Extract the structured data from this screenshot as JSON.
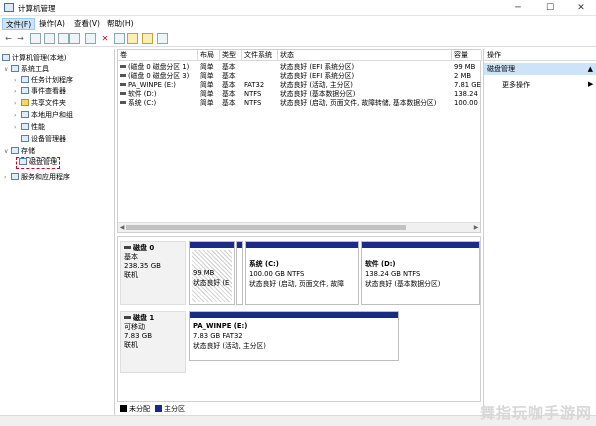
{
  "window": {
    "title": "计算机管理",
    "minimize": "─",
    "maximize": "☐",
    "close": "✕"
  },
  "menu": [
    "文件(F)",
    "操作(A)",
    "查看(V)",
    "帮助(H)"
  ],
  "toolbar": {
    "back": "←",
    "forward": "→",
    "delete": "✕"
  },
  "tree": {
    "root": "计算机管理(本地)",
    "system_tools": "系统工具",
    "task_scheduler": "任务计划程序",
    "event_viewer": "事件查看器",
    "shared_folders": "共享文件夹",
    "local_users": "本地用户和组",
    "performance": "性能",
    "device_manager": "设备管理器",
    "storage": "存储",
    "disk_management": "磁盘管理",
    "services": "服务和应用程序"
  },
  "table": {
    "headers": [
      "卷",
      "布局",
      "类型",
      "文件系统",
      "状态",
      "容量"
    ],
    "rows": [
      [
        "(磁盘 0 磁盘分区 1)",
        "简单",
        "基本",
        "",
        "状态良好 (EFI 系统分区)",
        "99 MB"
      ],
      [
        "(磁盘 0 磁盘分区 3)",
        "简单",
        "基本",
        "",
        "状态良好 (EFI 系统分区)",
        "2 MB"
      ],
      [
        "PA_WINPE (E:)",
        "简单",
        "基本",
        "FAT32",
        "状态良好 (活动, 主分区)",
        "7.81 GE"
      ],
      [
        "软件 (D:)",
        "简单",
        "基本",
        "NTFS",
        "状态良好 (基本数据分区)",
        "138.24"
      ],
      [
        "系统 (C:)",
        "简单",
        "基本",
        "NTFS",
        "状态良好 (启动, 页面文件, 故障转储, 基本数据分区)",
        "100.00"
      ]
    ],
    "scroll_left": "◀",
    "scroll_right": "▶"
  },
  "disk0": {
    "name": "磁盘 0",
    "type": "基本",
    "size": "238.35 GB",
    "status": "联机",
    "partitions": [
      {
        "title": "",
        "line1": "99 MB",
        "line2": "状态良好 (E"
      },
      {
        "title": "",
        "line1": "",
        "line2": ""
      },
      {
        "title": "系统  (C:)",
        "line1": "100.00 GB NTFS",
        "line2": "状态良好 (启动, 页面文件, 故障"
      },
      {
        "title": "软件  (D:)",
        "line1": "138.24 GB NTFS",
        "line2": "状态良好 (基本数据分区)"
      }
    ]
  },
  "disk1": {
    "name": "磁盘 1",
    "type": "可移动",
    "size": "7.83 GB",
    "status": "联机",
    "partitions": [
      {
        "title": "PA_WINPE  (E:)",
        "line1": "7.83 GB FAT32",
        "line2": "状态良好 (活动, 主分区)"
      }
    ]
  },
  "legend": [
    {
      "label": "未分配",
      "color": "#000000"
    },
    {
      "label": "主分区",
      "color": "#1a2b85"
    }
  ],
  "actions": {
    "title": "操作",
    "selected": "磁盘管理",
    "more": "更多操作"
  },
  "watermark": "舞指玩咖手游网"
}
